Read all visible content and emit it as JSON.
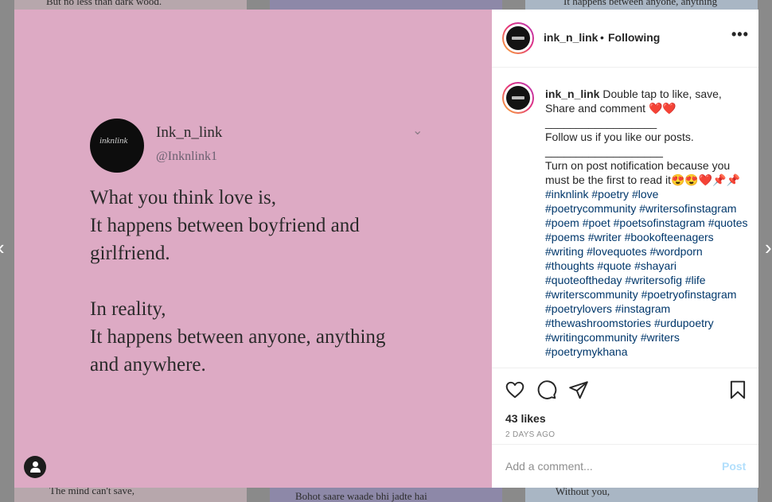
{
  "background_tiles": {
    "top_left": "But no less than dark wood.",
    "top_right": "It happens between anyone, anything",
    "bottom_left_1": "The mind can't save,",
    "bottom_mid_1": "Bohot saare waade bhi jadte hai",
    "bottom_right_1": "Without you,"
  },
  "post_image": {
    "name": "Ink_n_link",
    "handle": "@Inknlink1",
    "avatar_text": "inknlink",
    "quote_lines": [
      "What you think love is,",
      "It happens between boyfriend and",
      "girlfriend.",
      "In reality,",
      "It happens between anyone, anything",
      "and anywhere."
    ]
  },
  "header": {
    "username": "ink_n_link",
    "separator": "•",
    "follow_status": "Following",
    "more": "•••"
  },
  "caption": {
    "username": "ink_n_link",
    "line1": "Double tap to like, save, Share and comment ❤️❤️",
    "rule1": "__________________",
    "line2": "Follow us if you like our posts.",
    "rule2": "___________________",
    "line3": "Turn on post notification because you must be the first to read it😍😍❤️📌📌",
    "hashtags": "#inknlink #poetry #love #poetrycommunity #writersofinstagram #poem #poet #poetsofinstagram #quotes #poems #writer #bookofteenagers #writing #lovequotes #wordporn #thoughts #quote #shayari #quoteoftheday #writersofig #life #writerscommunity #poetryofinstagram #poetrylovers #instagram #thewashroomstories #urdupoetry #writingcommunity #writers #poetrymykhana"
  },
  "actions": {
    "likes": "43 likes",
    "date": "2 DAYS AGO"
  },
  "comment": {
    "placeholder": "Add a comment...",
    "post_label": "Post"
  },
  "colors": {
    "post_bg": "#ddaac4",
    "link": "#00376b",
    "post_button": "#b2dffc"
  }
}
